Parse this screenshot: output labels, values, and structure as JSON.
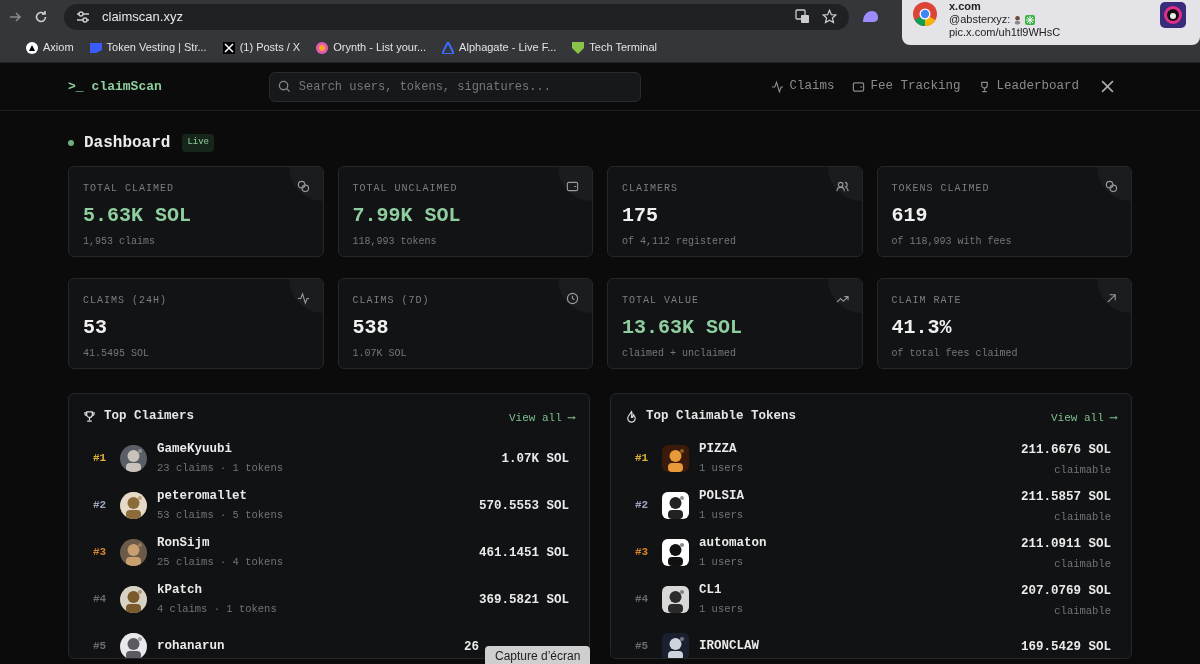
{
  "browser": {
    "url": "claimscan.xyz",
    "bookmarks": [
      "Axiom",
      "Token Vesting | Str...",
      "(1) Posts / X",
      "Orynth - List your...",
      "Alphagate - Live F...",
      "Tech Terminal"
    ]
  },
  "notification": {
    "title": "x.com",
    "text": "@absterxyz:",
    "link": "pic.x.com/uh1tl9WHsC"
  },
  "header": {
    "logo_mark": ">_",
    "logo": "claimScan",
    "search": {
      "placeholder": "Search users, tokens, signatures..."
    },
    "nav": [
      "Claims",
      "Fee Tracking",
      "Leaderboard"
    ]
  },
  "dashboard": {
    "title": "Dashboard",
    "badge": "Live"
  },
  "stats": [
    {
      "label": "TOTAL CLAIMED",
      "value": "5.63K SOL",
      "sub": "1,953 claims",
      "highlight": true
    },
    {
      "label": "TOTAL UNCLAIMED",
      "value": "7.99K SOL",
      "sub": "118,993 tokens",
      "highlight": true
    },
    {
      "label": "CLAIMERS",
      "value": "175",
      "sub": "of 4,112 registered",
      "highlight": false
    },
    {
      "label": "TOKENS CLAIMED",
      "value": "619",
      "sub": "of 118,993 with fees",
      "highlight": false
    },
    {
      "label": "CLAIMS (24H)",
      "value": "53",
      "sub": "41.5495 SOL",
      "highlight": false
    },
    {
      "label": "CLAIMS (7D)",
      "value": "538",
      "sub": "1.07K SOL",
      "highlight": false
    },
    {
      "label": "TOTAL VALUE",
      "value": "13.63K SOL",
      "sub": "claimed + unclaimed",
      "highlight": true
    },
    {
      "label": "CLAIM RATE",
      "value": "41.3%",
      "sub": "of total fees claimed",
      "highlight": false
    }
  ],
  "panels": [
    {
      "title": "Top Claimers",
      "link": "View all ⟶",
      "rows": [
        {
          "rank": "#1",
          "color": "#e0b13a",
          "name": "GameKyuubi",
          "sub": "23 claims · 1 tokens",
          "amount": "1.07K SOL"
        },
        {
          "rank": "#2",
          "color": "#9aa7bd",
          "name": "peteromallet",
          "sub": "53 claims · 5 tokens",
          "amount": "570.5553 SOL"
        },
        {
          "rank": "#3",
          "color": "#d9822b",
          "name": "RonSijm",
          "sub": "25 claims · 4 tokens",
          "amount": "461.1451 SOL"
        },
        {
          "rank": "#4",
          "color": "#6b6b6b",
          "name": "kPatch",
          "sub": "4 claims · 1 tokens",
          "amount": "369.5821 SOL"
        },
        {
          "rank": "#5",
          "color": "#6b6b6b",
          "name": "rohanarun",
          "amount": "26",
          "clipped": true
        }
      ]
    },
    {
      "title": "Top Claimable Tokens",
      "link": "View all ⟶",
      "rows": [
        {
          "rank": "#1",
          "color": "#e0b13a",
          "name": "PIZZA",
          "sub": "1 users",
          "amount": "211.6676 SOL",
          "note": "claimable"
        },
        {
          "rank": "#2",
          "color": "#9aa7bd",
          "name": "POLSIA",
          "sub": "1 users",
          "amount": "211.5857 SOL",
          "note": "claimable"
        },
        {
          "rank": "#3",
          "color": "#d9822b",
          "name": "automaton",
          "sub": "1 users",
          "amount": "211.0911 SOL",
          "note": "claimable"
        },
        {
          "rank": "#4",
          "color": "#6b6b6b",
          "name": "CL1",
          "sub": "1 users",
          "amount": "207.0769 SOL",
          "note": "claimable"
        },
        {
          "rank": "#5",
          "color": "#6b6b6b",
          "name": "IRONCLAW",
          "amount": "169.5429 SOL"
        }
      ]
    }
  ],
  "tooltip": "Capture d’écran"
}
